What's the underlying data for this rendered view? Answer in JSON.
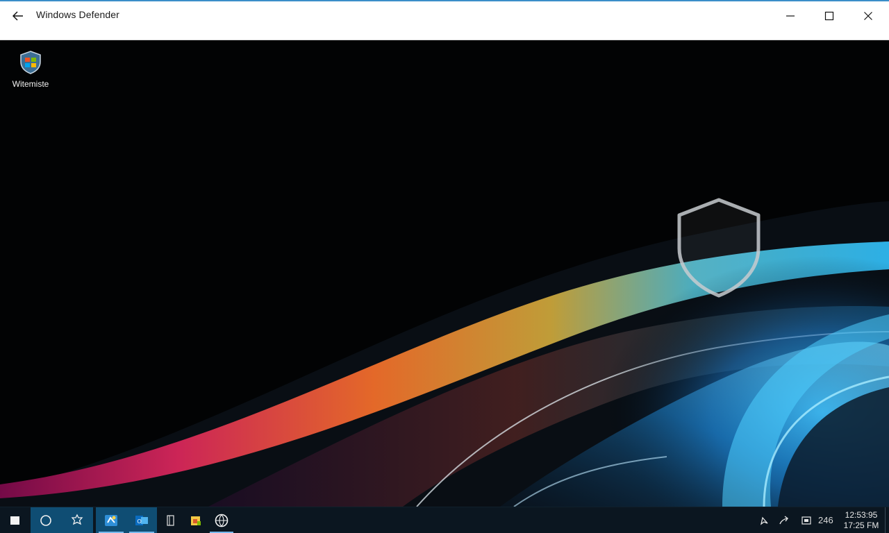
{
  "window": {
    "title": "Windows Defender",
    "back_icon": "back-arrow-icon",
    "minimize_icon": "minimize-icon",
    "maximize_icon": "maximize-icon",
    "close_icon": "close-icon"
  },
  "desktop": {
    "icon_label": "Witemiste",
    "icon_name": "windows-shield-icon",
    "watermark_icon": "shield-outline-icon"
  },
  "taskbar": {
    "start_icon": "windows-start-icon",
    "search_icon": "cortana-circle-icon",
    "taskview_icon": "task-view-icon",
    "pinned": [
      {
        "name": "edge-app-icon"
      },
      {
        "name": "outlook-app-icon"
      },
      {
        "name": "document-app-icon"
      },
      {
        "name": "file-explorer-icon"
      },
      {
        "name": "defender-globe-icon"
      }
    ],
    "tray": {
      "pen_icon": "pen-icon",
      "arrow_icon": "share-arrow-icon",
      "screen_icon": "display-icon",
      "count": "246",
      "clock_time": "12:53:95",
      "clock_date": "17:25 FM"
    }
  },
  "colors": {
    "titlebar_bg": "#ffffff",
    "taskbar_bg": "#0b1620",
    "taskbar_active": "#0f4d73",
    "accent": "#3a8ec9"
  }
}
